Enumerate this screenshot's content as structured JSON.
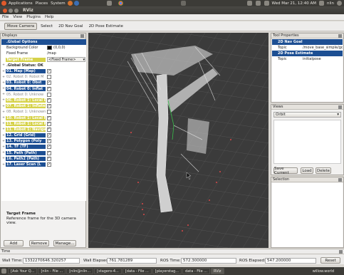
{
  "top_panel": {
    "menus": [
      "Applications",
      "Places",
      "System"
    ],
    "datetime": "Wed Mar 21, 12:40 AM",
    "user": "nlin"
  },
  "window": {
    "title": "RViz"
  },
  "menubar": {
    "items": [
      "File",
      "View",
      "Plugins",
      "Help"
    ]
  },
  "toolbar": {
    "tools": [
      "Move Camera",
      "Select",
      "2D Nav Goal",
      "2D Pose Estimate"
    ]
  },
  "displays": {
    "header": "Displays",
    "rows": [
      {
        "label": ".Global Options",
        "value": "",
        "style": "sel",
        "exp": "-"
      },
      {
        "label": "Background Color",
        "value": "(0,0,0)",
        "style": "",
        "exp": "",
        "swatch": "#000000"
      },
      {
        "label": "Fixed Frame",
        "value": "/map",
        "style": "",
        "exp": ""
      },
      {
        "label": "Target Frame",
        "value": "<Fixed Frame>",
        "style": "yellow",
        "exp": "",
        "dropdown": true
      },
      {
        "label": ".Global Status: OK",
        "value": "",
        "style": "bold",
        "exp": "+"
      },
      {
        "label": "01. Map (Map)",
        "value": "",
        "style": "dark",
        "exp": "+",
        "check": true
      },
      {
        "label": "02. Robot 0: Robot M",
        "value": "",
        "style": "gray",
        "exp": "+",
        "check": false
      },
      {
        "label": "03. Robot 0: Obst",
        "value": "",
        "style": "dark",
        "exp": "+",
        "check": true
      },
      {
        "label": "04. Robot 0: Inflat",
        "value": "",
        "style": "dark",
        "exp": "+",
        "check": true
      },
      {
        "label": "05. Robot 0: Unknow",
        "value": "",
        "style": "gray",
        "exp": "+",
        "check": false
      },
      {
        "label": "06. Robot 1: Local P",
        "value": "",
        "style": "yellow",
        "exp": "+",
        "check": true
      },
      {
        "label": "07. Robot 1: Inflated",
        "value": "",
        "style": "yellow",
        "exp": "+",
        "check": true
      },
      {
        "label": "08. Robot 1: Unknown",
        "value": "",
        "style": "gray",
        "exp": "+",
        "check": false
      },
      {
        "label": "10. Robot 1: Local Pl",
        "value": "",
        "style": "yellow",
        "exp": "+",
        "check": true
      },
      {
        "label": "11. Robot 1: Local P",
        "value": "",
        "style": "yellow",
        "exp": "+",
        "check": true
      },
      {
        "label": "11. Robot 1: Naviga",
        "value": "",
        "style": "yellow",
        "exp": "+",
        "check": true
      },
      {
        "label": "12. Grid (Grid)",
        "value": "",
        "style": "dark",
        "exp": "+",
        "check": true
      },
      {
        "label": "13. Polygon (Poly",
        "value": "",
        "style": "dark",
        "exp": "+",
        "check": true
      },
      {
        "label": "14. TF (TF)",
        "value": "",
        "style": "dark",
        "exp": "+",
        "check": true
      },
      {
        "label": "15. Path (Path)",
        "value": "",
        "style": "dark",
        "exp": "+",
        "check": true
      },
      {
        "label": "16. Path2 (Path)",
        "value": "",
        "style": "dark",
        "exp": "+",
        "check": true
      },
      {
        "label": "17. Laser Scan (L",
        "value": "",
        "style": "dark",
        "exp": "+",
        "check": true
      }
    ],
    "desc_title": "Target Frame",
    "desc_text": "Reference frame for the 3D camera view.",
    "buttons": [
      "Add",
      "Remove",
      "Manage..."
    ]
  },
  "tool_properties": {
    "header": "Tool Properties",
    "rows": [
      {
        "label": "2D Nav Goal",
        "value": "",
        "sel": true
      },
      {
        "label": "Topic",
        "value": "/move_base_simple/goal",
        "sel": false
      },
      {
        "label": "2D Pose Estimate",
        "value": "",
        "sel": true
      },
      {
        "label": "Topic",
        "value": "initialpose",
        "sel": false
      }
    ]
  },
  "views": {
    "header": "Views",
    "selected": "Orbit",
    "buttons": [
      "Save Current",
      "Load",
      "Delete"
    ]
  },
  "selection": {
    "header": "Selection"
  },
  "time": {
    "header": "Time",
    "wall_time_label": "Wall Time:",
    "wall_time": "1332270646.320257",
    "wall_elapsed_label": "Wall Elapsed:",
    "wall_elapsed": "761.781289",
    "ros_time_label": "ROS Time:",
    "ros_time": "572.300000",
    "ros_elapsed_label": "ROS Elapsed:",
    "ros_elapsed": "547.200000",
    "reset": "Reset"
  },
  "taskbar": {
    "items": [
      "[Ask Your Q...",
      "[nlin - File ...",
      "[nlin@nlin...",
      "[stagero-4...",
      "[data - File ...",
      "[playerstag...",
      "data - File ...",
      "RViz"
    ],
    "right": "willow.world"
  }
}
